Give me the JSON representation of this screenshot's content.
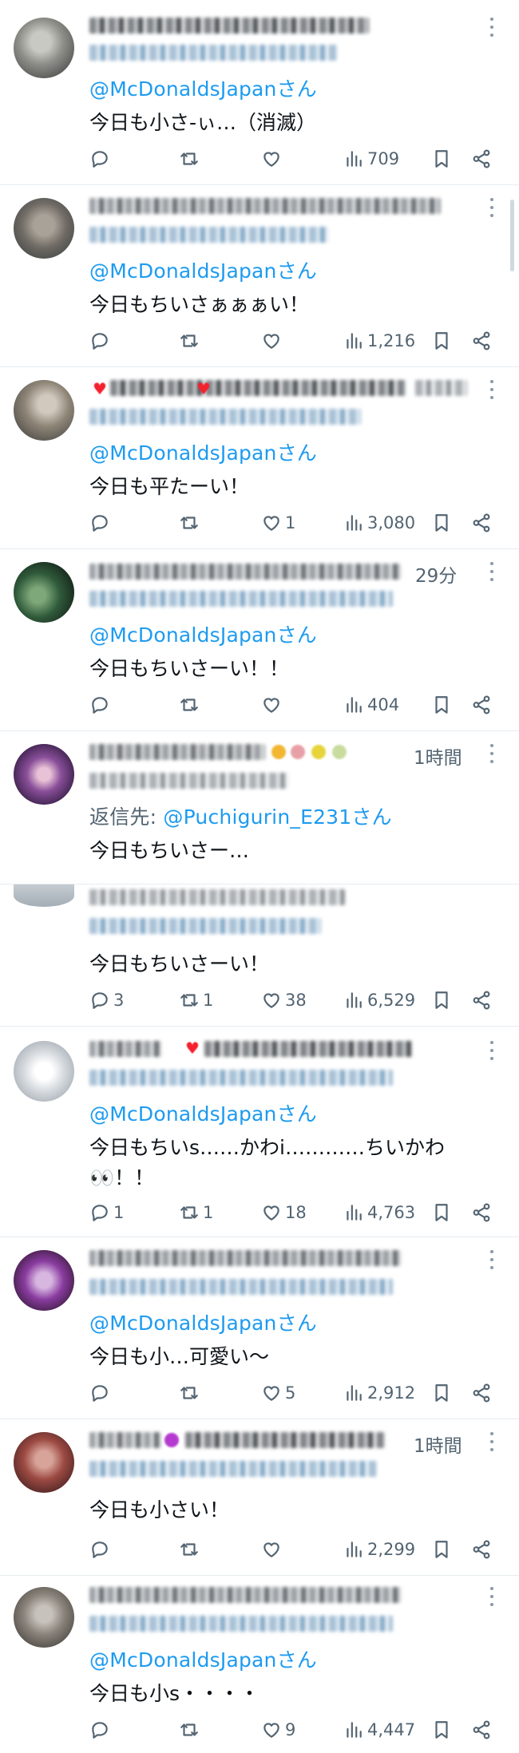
{
  "app": {
    "accent_color": "#1d9bf0",
    "text_color": "#0f1419",
    "muted_color": "#536471"
  },
  "tweets": [
    {
      "time": "",
      "reply_label": "",
      "mention": "@McDonaldsJapan",
      "mention_suffix": "さん",
      "text": "今日も小さ-ぃ…（消滅）",
      "text2": "",
      "replies": "",
      "retweets": "",
      "likes": "",
      "views": "709"
    },
    {
      "time": "",
      "reply_label": "",
      "mention": "@McDonaldsJapan",
      "mention_suffix": "さん",
      "text": "今日もちいさぁぁぁい！",
      "text2": "",
      "replies": "",
      "retweets": "",
      "likes": "",
      "views": "1,216"
    },
    {
      "time": "",
      "reply_label": "",
      "mention": "@McDonaldsJapan",
      "mention_suffix": "さん",
      "text": "今日も平たーい！",
      "text2": "",
      "replies": "",
      "retweets": "",
      "likes": "1",
      "views": "3,080"
    },
    {
      "time": "29分",
      "reply_label": "",
      "mention": "@McDonaldsJapan",
      "mention_suffix": "さん",
      "text": "今日もちいさーい！！",
      "text2": "",
      "replies": "",
      "retweets": "",
      "likes": "",
      "views": "404"
    },
    {
      "time": "1時間",
      "reply_label": "返信先: ",
      "mention": "@Puchigurin_E231",
      "mention_suffix": "さん",
      "text": "今日もちいさー…",
      "text2": ""
    },
    {
      "time": "",
      "reply_label": "",
      "mention": "",
      "mention_suffix": "",
      "text": "今日もちいさーい！",
      "text2": "",
      "replies": "3",
      "retweets": "1",
      "likes": "38",
      "views": "6,529"
    },
    {
      "time": "",
      "reply_label": "",
      "mention": "@McDonaldsJapan",
      "mention_suffix": "さん",
      "text": "今日もちいs……かわi…………ちいかわ",
      "text2": "👀！！",
      "replies": "1",
      "retweets": "1",
      "likes": "18",
      "views": "4,763"
    },
    {
      "time": "",
      "reply_label": "",
      "mention": "@McDonaldsJapan",
      "mention_suffix": "さん",
      "text": "今日も小…可愛い〜",
      "text2": "",
      "replies": "",
      "retweets": "",
      "likes": "5",
      "views": "2,912"
    },
    {
      "time": "1時間",
      "reply_label": "",
      "mention": "",
      "mention_suffix": "",
      "text": "今日も小さい！",
      "text2": "",
      "replies": "",
      "retweets": "",
      "likes": "",
      "views": "2,299"
    },
    {
      "time": "",
      "reply_label": "",
      "mention": "@McDonaldsJapan",
      "mention_suffix": "さん",
      "text": "今日も小s・・・・",
      "text2": "",
      "replies": "",
      "retweets": "",
      "likes": "9",
      "views": "4,447"
    }
  ],
  "icons": {
    "reply": "reply-icon",
    "retweet": "retweet-icon",
    "like": "heart-icon",
    "views": "views-icon",
    "bookmark": "bookmark-icon",
    "share": "share-icon",
    "more": "more-icon"
  }
}
